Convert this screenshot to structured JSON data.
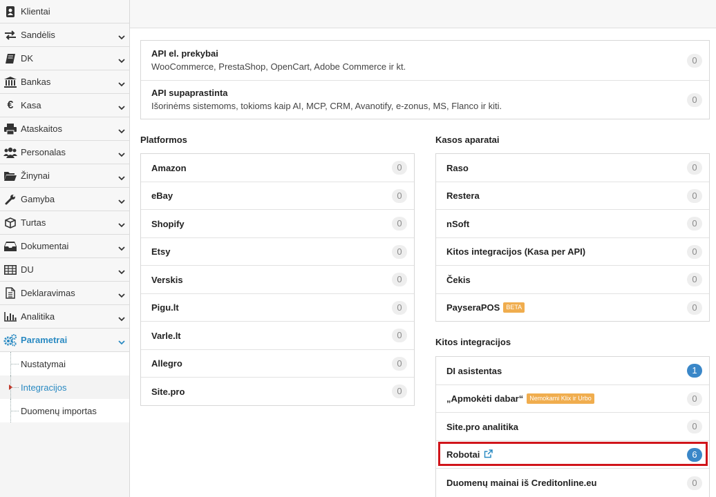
{
  "sidebar": {
    "items": [
      {
        "label": "Klientai",
        "icon": "address-book-icon"
      },
      {
        "label": "Sandėlis",
        "icon": "exchange-icon"
      },
      {
        "label": "DK",
        "icon": "book-icon"
      },
      {
        "label": "Bankas",
        "icon": "bank-icon"
      },
      {
        "label": "Kasa",
        "icon": "euro-icon"
      },
      {
        "label": "Ataskaitos",
        "icon": "print-icon"
      },
      {
        "label": "Personalas",
        "icon": "users-icon"
      },
      {
        "label": "Žinynai",
        "icon": "folder-open-icon"
      },
      {
        "label": "Gamyba",
        "icon": "wrench-icon"
      },
      {
        "label": "Turtas",
        "icon": "cube-icon"
      },
      {
        "label": "Dokumentai",
        "icon": "inbox-icon"
      },
      {
        "label": "DU",
        "icon": "table-icon"
      },
      {
        "label": "Deklaravimas",
        "icon": "file-text-icon"
      },
      {
        "label": "Analitika",
        "icon": "bar-chart-icon"
      },
      {
        "label": "Parametrai",
        "icon": "gears-icon"
      }
    ],
    "subitems": [
      {
        "label": "Nustatymai"
      },
      {
        "label": "Integracijos"
      },
      {
        "label": "Duomenų importas"
      }
    ]
  },
  "api": [
    {
      "name": "API el. prekybai",
      "desc": "WooCommerce, PrestaShop, OpenCart, Adobe Commerce ir kt.",
      "count": "0"
    },
    {
      "name": "API supaprastinta",
      "desc": "Išorinėms sistemoms, tokioms kaip AI, MCP, CRM, Avanotify, e-zonus, MS, Flanco ir kiti.",
      "count": "0"
    }
  ],
  "platformos": {
    "title": "Platformos",
    "items": [
      {
        "name": "Amazon",
        "count": "0"
      },
      {
        "name": "eBay",
        "count": "0"
      },
      {
        "name": "Shopify",
        "count": "0"
      },
      {
        "name": "Etsy",
        "count": "0"
      },
      {
        "name": "Verskis",
        "count": "0"
      },
      {
        "name": "Pigu.lt",
        "count": "0"
      },
      {
        "name": "Varle.lt",
        "count": "0"
      },
      {
        "name": "Allegro",
        "count": "0"
      },
      {
        "name": "Site.pro",
        "count": "0"
      }
    ]
  },
  "kasos": {
    "title": "Kasos aparatai",
    "items": [
      {
        "name": "Raso",
        "count": "0"
      },
      {
        "name": "Restera",
        "count": "0"
      },
      {
        "name": "nSoft",
        "count": "0"
      },
      {
        "name": "Kitos integracijos (Kasa per API)",
        "count": "0"
      },
      {
        "name": "Čekis",
        "count": "0"
      },
      {
        "name": "PayseraPOS",
        "count": "0",
        "tag": "BETA"
      }
    ]
  },
  "kitos": {
    "title": "Kitos integracijos",
    "items": [
      {
        "name": "DI asistentas",
        "count": "1"
      },
      {
        "name": "„Apmokėti dabar“",
        "count": "0",
        "tag": "Nemokami Klix ir Urbo"
      },
      {
        "name": "Site.pro analitika",
        "count": "0"
      },
      {
        "name": "Robotai",
        "count": "6"
      },
      {
        "name": "Duomenų mainai iš Creditonline.eu",
        "count": "0"
      }
    ]
  },
  "colors": {
    "accent": "#2a8ac2",
    "badge_blue": "#3a87c8",
    "highlight": "#d0141a",
    "tag": "#f0ad4e"
  }
}
